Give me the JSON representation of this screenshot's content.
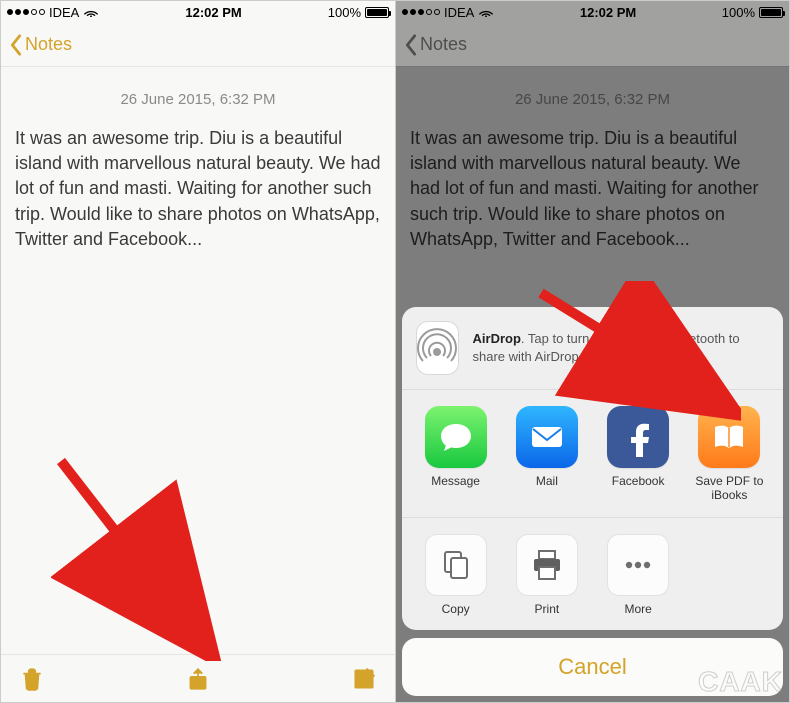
{
  "status": {
    "carrier": "IDEA",
    "time": "12:02 PM",
    "battery_pct": "100%"
  },
  "nav": {
    "back_label": "Notes"
  },
  "note": {
    "date": "26 June 2015, 6:32 PM",
    "body": "It was an awesome trip. Diu is a beautiful island with marvellous natural beauty. We had lot of fun and masti. Waiting for another such trip. Would like to share photos on WhatsApp, Twitter and Facebook..."
  },
  "share_sheet": {
    "airdrop": {
      "title": "AirDrop",
      "message": ". Tap to turn on Wi-Fi and Bluetooth to share with AirDrop."
    },
    "apps": [
      {
        "label": "Message"
      },
      {
        "label": "Mail"
      },
      {
        "label": "Facebook"
      },
      {
        "label": "Save PDF to iBooks"
      }
    ],
    "actions": [
      {
        "label": "Copy"
      },
      {
        "label": "Print"
      },
      {
        "label": "More"
      }
    ],
    "cancel": "Cancel"
  },
  "watermark": "CAAK"
}
